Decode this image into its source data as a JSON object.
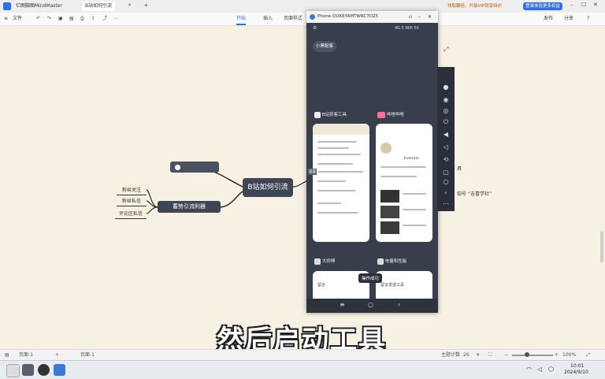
{
  "app": {
    "tab1": "亿图脑图MindMaster",
    "tab2": "B站如何引流",
    "tab3": "B站如何引流"
  },
  "promo": {
    "text1": "领取翻倍，升级VIP就享特价",
    "text2": "登录体验更多权益"
  },
  "toolbar": {
    "file": "文件",
    "tabs": [
      "开始",
      "插入",
      "页面样式",
      "高级",
      "视图"
    ],
    "active_tab": "开始",
    "right": [
      "发布",
      "分享",
      "帮助"
    ]
  },
  "mindmap": {
    "central": "B站如何引流",
    "left_main": "蓄势引流利器",
    "left_leaves": [
      "粉丝关注",
      "粉丝私信",
      "评论区私信"
    ],
    "right_partial_1": "具",
    "right_partial_2": "铂号 “吉喜学社”"
  },
  "phone": {
    "title": "Phone-OUK6YAMTWRC7DZ5",
    "status": "4G 5 Wifi 50",
    "header_label": "小黑配客",
    "apps": [
      {
        "name": "B站获客工具"
      },
      {
        "name": "哔哩哔哩"
      },
      {
        "name": "大师傅"
      },
      {
        "name": "电量和性能"
      }
    ],
    "toast": "操作成功",
    "card1_tag": "设置",
    "card2_tag": "留言发送工具",
    "card_bottom_label": "留言",
    "bili_user": "Everrain"
  },
  "subtitle": "然后启动工具",
  "status": {
    "page": "页面-1",
    "page2": "页面-1",
    "topic_count_label": "主题计数",
    "topic_count": "26",
    "zoom": "100%"
  },
  "taskbar": {
    "time": "10:01",
    "date": "2024/9/10"
  }
}
